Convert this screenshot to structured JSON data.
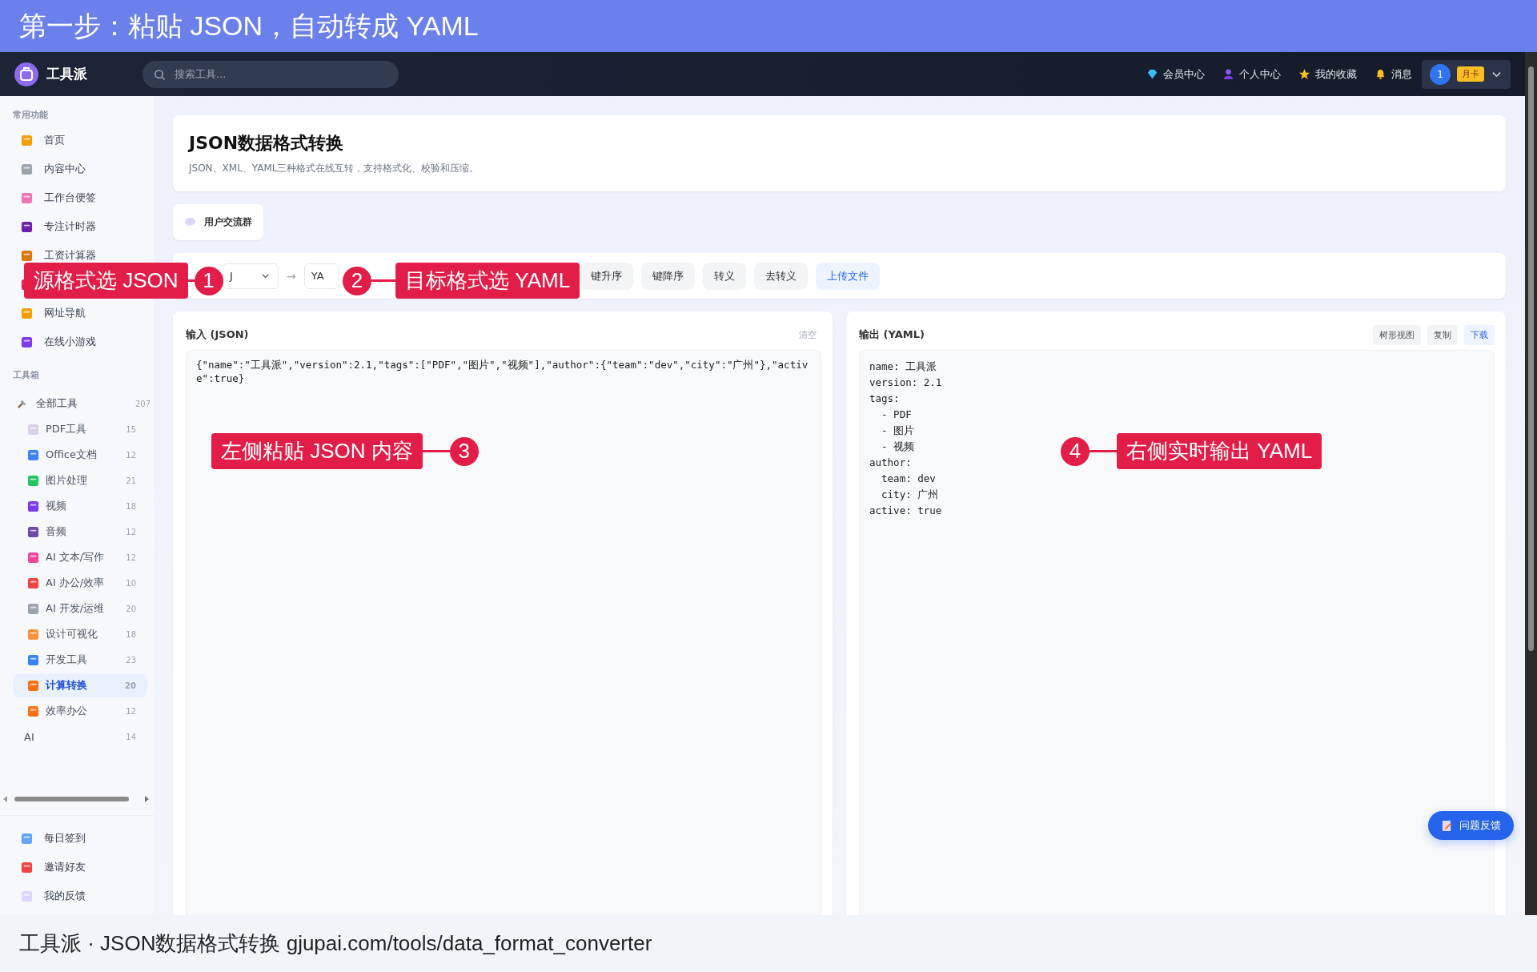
{
  "banner": {
    "title": "第一步：粘贴 JSON，自动转成 YAML"
  },
  "nav": {
    "brand": "工具派",
    "search": {
      "placeholder": "搜索工具..."
    },
    "links": [
      {
        "label": "会员中心"
      },
      {
        "label": "个人中心"
      },
      {
        "label": "我的收藏"
      },
      {
        "label": "消息"
      }
    ],
    "user": {
      "avatar": "1",
      "badge": "月卡"
    }
  },
  "sidebar": {
    "sections": [
      {
        "title": "常用功能",
        "items": [
          {
            "kind": "entry",
            "label": "首页",
            "selected": false
          },
          {
            "kind": "entry",
            "label": "内容中心",
            "selected": false
          },
          {
            "kind": "entry",
            "label": "工作台便签",
            "selected": false
          },
          {
            "kind": "entry",
            "label": "专注计时器",
            "selected": false
          },
          {
            "kind": "entry",
            "label": "工资计算器",
            "selected": false
          },
          {
            "kind": "covered",
            "selected": false
          },
          {
            "kind": "entry",
            "label": "网址导航",
            "selected": false
          },
          {
            "kind": "entry",
            "label": "在线小游戏",
            "selected": false
          }
        ]
      },
      {
        "title": "工具箱",
        "tree": {
          "label": "全部工具",
          "count": "207",
          "children": [
            {
              "kind": "icon",
              "label": "PDF工具",
              "count": "15",
              "selected": false
            },
            {
              "kind": "icon",
              "label": "Office文档",
              "count": "12",
              "selected": false
            },
            {
              "kind": "icon",
              "label": "图片处理",
              "count": "21",
              "selected": false
            },
            {
              "kind": "icon",
              "label": "视频",
              "count": "18",
              "selected": false
            },
            {
              "kind": "icon",
              "label": "音频",
              "count": "12",
              "selected": false
            },
            {
              "kind": "icon",
              "label": "AI 文本/写作",
              "count": "12",
              "selected": false
            },
            {
              "kind": "icon",
              "label": "AI 办公/效率",
              "count": "10",
              "selected": false
            },
            {
              "kind": "icon",
              "label": "AI 开发/运维",
              "count": "20",
              "selected": false
            },
            {
              "kind": "icon",
              "label": "设计可视化",
              "count": "18",
              "selected": false
            },
            {
              "kind": "icon",
              "label": "开发工具",
              "count": "23",
              "selected": false
            },
            {
              "kind": "icon",
              "label": "计算转换",
              "count": "20",
              "selected": true
            },
            {
              "kind": "icon",
              "label": "效率办公",
              "count": "12",
              "selected": false
            },
            {
              "kind": "plain",
              "label": "AI",
              "count": "14",
              "selected": false
            }
          ]
        }
      }
    ],
    "footer_items": [
      {
        "label": "每日签到"
      },
      {
        "label": "邀请好友"
      },
      {
        "label": "我的反馈"
      }
    ]
  },
  "header": {
    "title": "JSON数据格式转换",
    "subtitle": "JSON、XML、YAML三种格式在线互转，支持格式化、校验和压缩。"
  },
  "group_button": {
    "label": "用户交流群"
  },
  "toolbar": {
    "source_select": "J",
    "arrow": "→",
    "target_select": "YA",
    "buttons": [
      {
        "label": "键升序",
        "kind": "plain"
      },
      {
        "label": "键降序",
        "kind": "plain"
      },
      {
        "label": "转义",
        "kind": "plain"
      },
      {
        "label": "去转义",
        "kind": "plain"
      },
      {
        "label": "上传文件",
        "kind": "primary"
      }
    ]
  },
  "input_panel": {
    "title": "输入 (JSON)",
    "clear": "清空",
    "value": "{\"name\":\"工具派\",\"version\":2.1,\"tags\":[\"PDF\",\"图片\",\"视频\"],\"author\":{\"team\":\"dev\",\"city\":\"广州\"},\"active\":true}"
  },
  "output_panel": {
    "title": "输出 (YAML)",
    "buttons": [
      {
        "label": "树形视图",
        "kind": "plain"
      },
      {
        "label": "复制",
        "kind": "plain"
      },
      {
        "label": "下载",
        "kind": "primary"
      }
    ],
    "lines": [
      "name: 工具派",
      "version: 2.1",
      "tags:",
      "  - PDF",
      "  - 图片",
      "  - 视频",
      "author:",
      "  team: dev",
      "  city: 广州",
      "active: true"
    ]
  },
  "feedback_button": {
    "label": "问题反馈"
  },
  "annotations": [
    {
      "number": "1",
      "label": "源格式选 JSON",
      "kind": "label-first"
    },
    {
      "number": "2",
      "label": "目标格式选 YAML",
      "kind": "circle-first"
    },
    {
      "number": "3",
      "label": "左侧粘贴 JSON 内容",
      "kind": "label-first"
    },
    {
      "number": "4",
      "label": "右侧实时输出 YAML",
      "kind": "circle-first"
    }
  ],
  "caption": {
    "text": "工具派 · JSON数据格式转换 gjupai.com/tools/data_format_converter"
  }
}
